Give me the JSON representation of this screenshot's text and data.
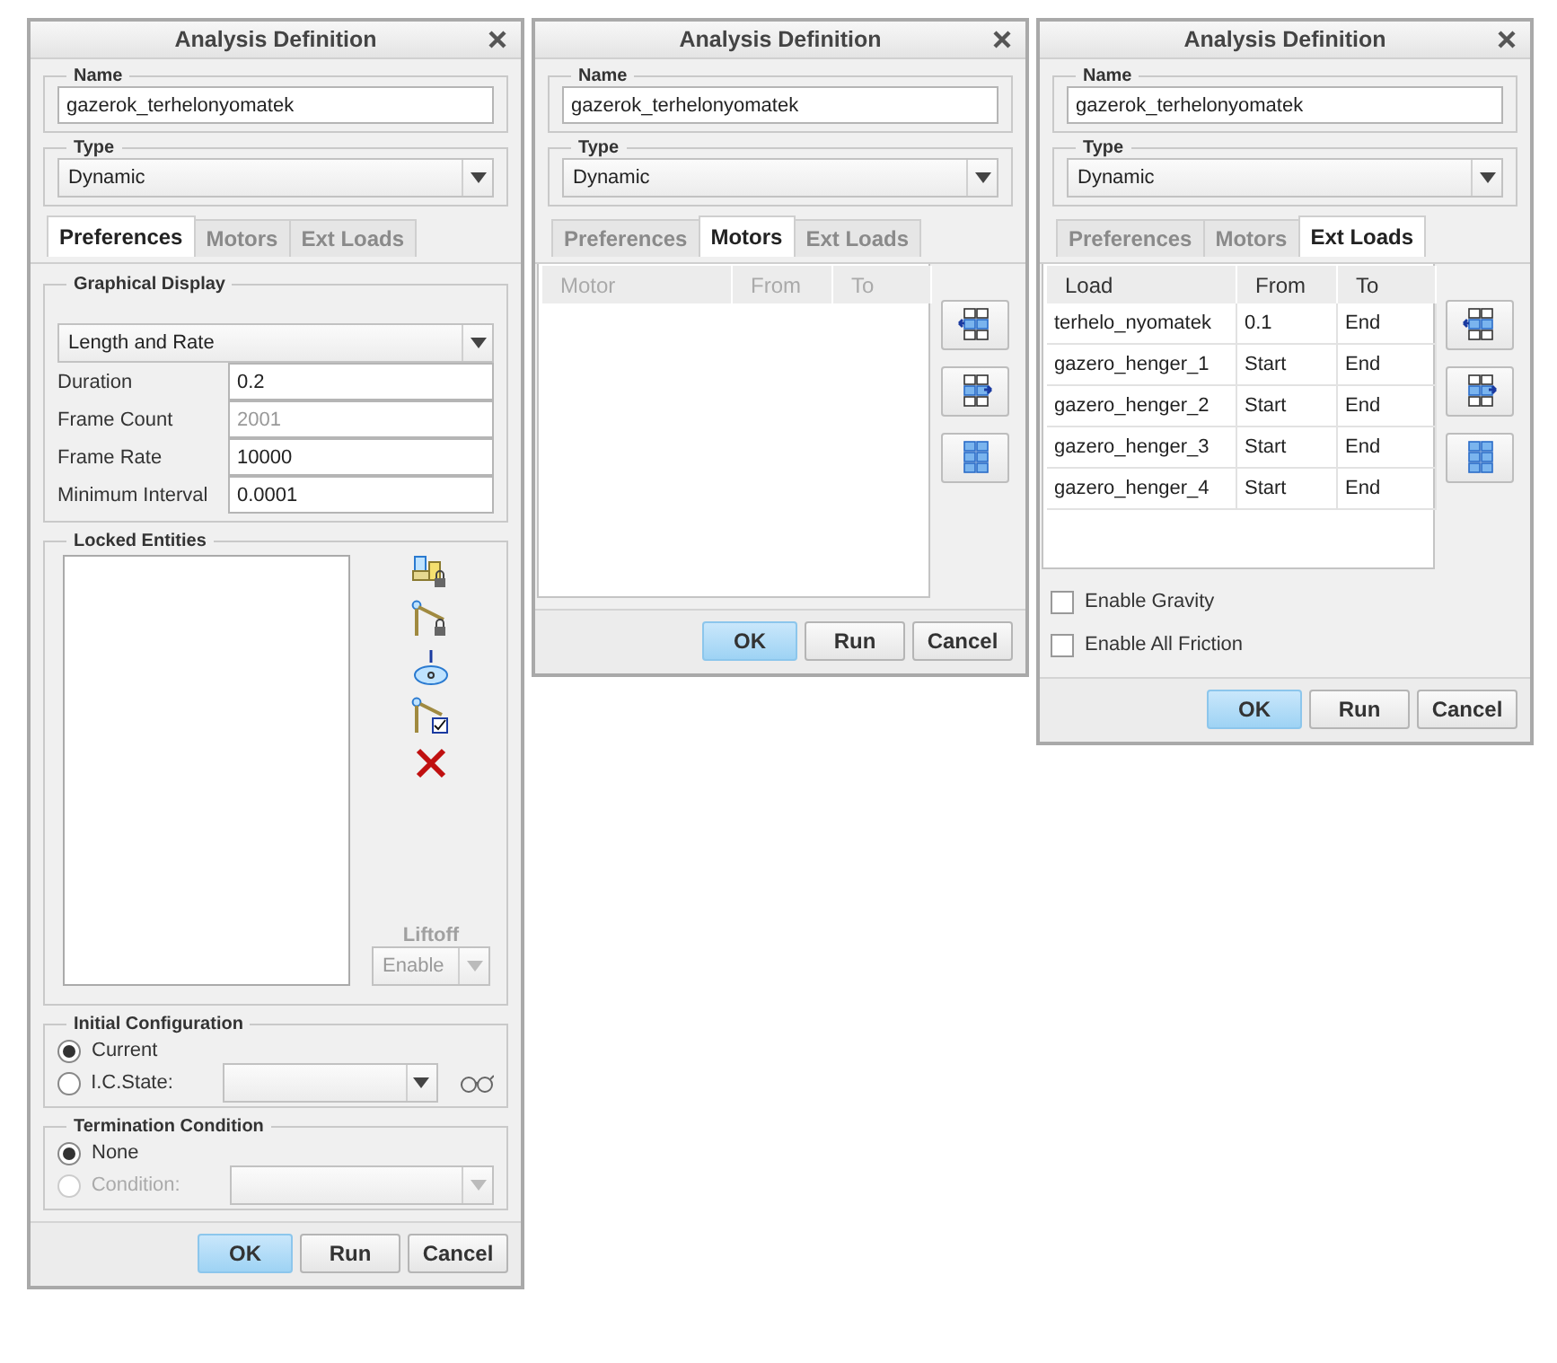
{
  "dialogs": [
    {
      "title": "Analysis Definition",
      "name": {
        "label": "Name",
        "value": "gazerok_terhelonyomatek"
      },
      "type": {
        "label": "Type",
        "value": "Dynamic"
      },
      "tabs": [
        {
          "label": "Preferences",
          "selected": true
        },
        {
          "label": "Motors",
          "selected": false
        },
        {
          "label": "Ext Loads",
          "selected": false
        }
      ],
      "panel": {
        "kind": "preferences",
        "graphical_display": {
          "title": "Graphical Display",
          "mode": "Length and Rate",
          "fields": [
            {
              "label": "Duration",
              "value": "0.2",
              "disabled": false
            },
            {
              "label": "Frame Count",
              "value": "2001",
              "disabled": true
            },
            {
              "label": "Frame Rate",
              "value": "10000",
              "disabled": false
            },
            {
              "label": "Minimum Interval",
              "value": "0.0001",
              "disabled": false
            }
          ]
        },
        "locked_entities": {
          "title": "Locked Entities",
          "liftoff": {
            "label": "Liftoff",
            "value": "Enable",
            "disabled": true
          }
        },
        "initial_configuration": {
          "title": "Initial Configuration",
          "options": [
            {
              "label": "Current",
              "selected": true,
              "disabled": false,
              "kind": "plain"
            },
            {
              "label": "I.C.State:",
              "selected": false,
              "disabled": false,
              "kind": "state"
            }
          ]
        },
        "termination_condition": {
          "title": "Termination Condition",
          "options": [
            {
              "label": "None",
              "selected": true,
              "disabled": false,
              "kind": "plain"
            },
            {
              "label": "Condition:",
              "selected": false,
              "disabled": true,
              "kind": "condition"
            }
          ]
        }
      },
      "buttons": [
        {
          "label": "OK",
          "default": true
        },
        {
          "label": "Run",
          "default": false
        },
        {
          "label": "Cancel",
          "default": false
        }
      ]
    },
    {
      "title": "Analysis Definition",
      "name": {
        "label": "Name",
        "value": "gazerok_terhelonyomatek"
      },
      "type": {
        "label": "Type",
        "value": "Dynamic"
      },
      "tabs": [
        {
          "label": "Preferences",
          "selected": false
        },
        {
          "label": "Motors",
          "selected": true
        },
        {
          "label": "Ext Loads",
          "selected": false
        }
      ],
      "panel": {
        "kind": "table",
        "disabled": true,
        "columns": [
          "Motor",
          "From",
          "To"
        ]
      },
      "buttons": [
        {
          "label": "OK",
          "default": true
        },
        {
          "label": "Run",
          "default": false
        },
        {
          "label": "Cancel",
          "default": false
        }
      ]
    },
    {
      "title": "Analysis Definition",
      "name": {
        "label": "Name",
        "value": "gazerok_terhelonyomatek"
      },
      "type": {
        "label": "Type",
        "value": "Dynamic"
      },
      "tabs": [
        {
          "label": "Preferences",
          "selected": false
        },
        {
          "label": "Motors",
          "selected": false
        },
        {
          "label": "Ext Loads",
          "selected": true
        }
      ],
      "panel": {
        "kind": "table",
        "disabled": false,
        "columns": [
          "Load",
          "From",
          "To"
        ],
        "rows": [
          [
            "terhelo_nyomatek",
            "0.1",
            "End"
          ],
          [
            "gazero_henger_1",
            "Start",
            "End"
          ],
          [
            "gazero_henger_2",
            "Start",
            "End"
          ],
          [
            "gazero_henger_3",
            "Start",
            "End"
          ],
          [
            "gazero_henger_4",
            "Start",
            "End"
          ]
        ],
        "checkboxes": [
          {
            "label": "Enable Gravity",
            "checked": false
          },
          {
            "label": "Enable All Friction",
            "checked": false
          }
        ]
      },
      "buttons": [
        {
          "label": "OK",
          "default": true
        },
        {
          "label": "Run",
          "default": false
        },
        {
          "label": "Cancel",
          "default": false
        }
      ]
    }
  ]
}
